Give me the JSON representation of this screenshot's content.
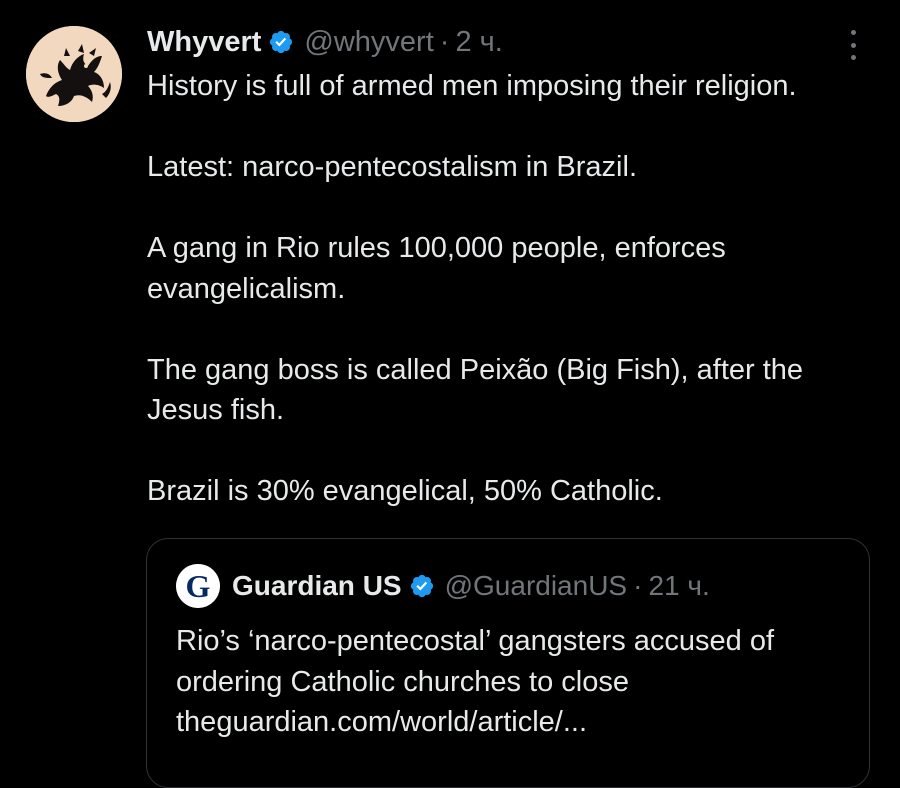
{
  "author": {
    "display_name": "Whyvert",
    "handle": "@whyvert",
    "separator": "·",
    "time": "2 ч.",
    "avatar_icon": "dragon-crest-icon"
  },
  "tweet": {
    "paragraphs": [
      "History is full of armed men imposing their religion.",
      "Latest: narco-pentecostalism in Brazil.",
      "A gang in Rio rules 100,000 people, enforces evangelicalism.",
      "The gang boss is called Peixão (Big Fish), after the Jesus fish.",
      "Brazil is 30% evangelical, 50% Catholic."
    ]
  },
  "quote": {
    "display_name": "Guardian US",
    "handle": "@GuardianUS",
    "separator": "·",
    "time": "21 ч.",
    "logo_letter": "G",
    "text_lines": [
      "Rio’s ‘narco-pentecostal’ gangsters accused of",
      "ordering Catholic churches to close",
      "theguardian.com/world/article/..."
    ]
  },
  "colors": {
    "background": "#000000",
    "text_primary": "#e7e9ea",
    "text_secondary": "#71767b",
    "verified": "#1d9bf0",
    "border": "#2f3336",
    "guardian_blue": "#052962"
  }
}
